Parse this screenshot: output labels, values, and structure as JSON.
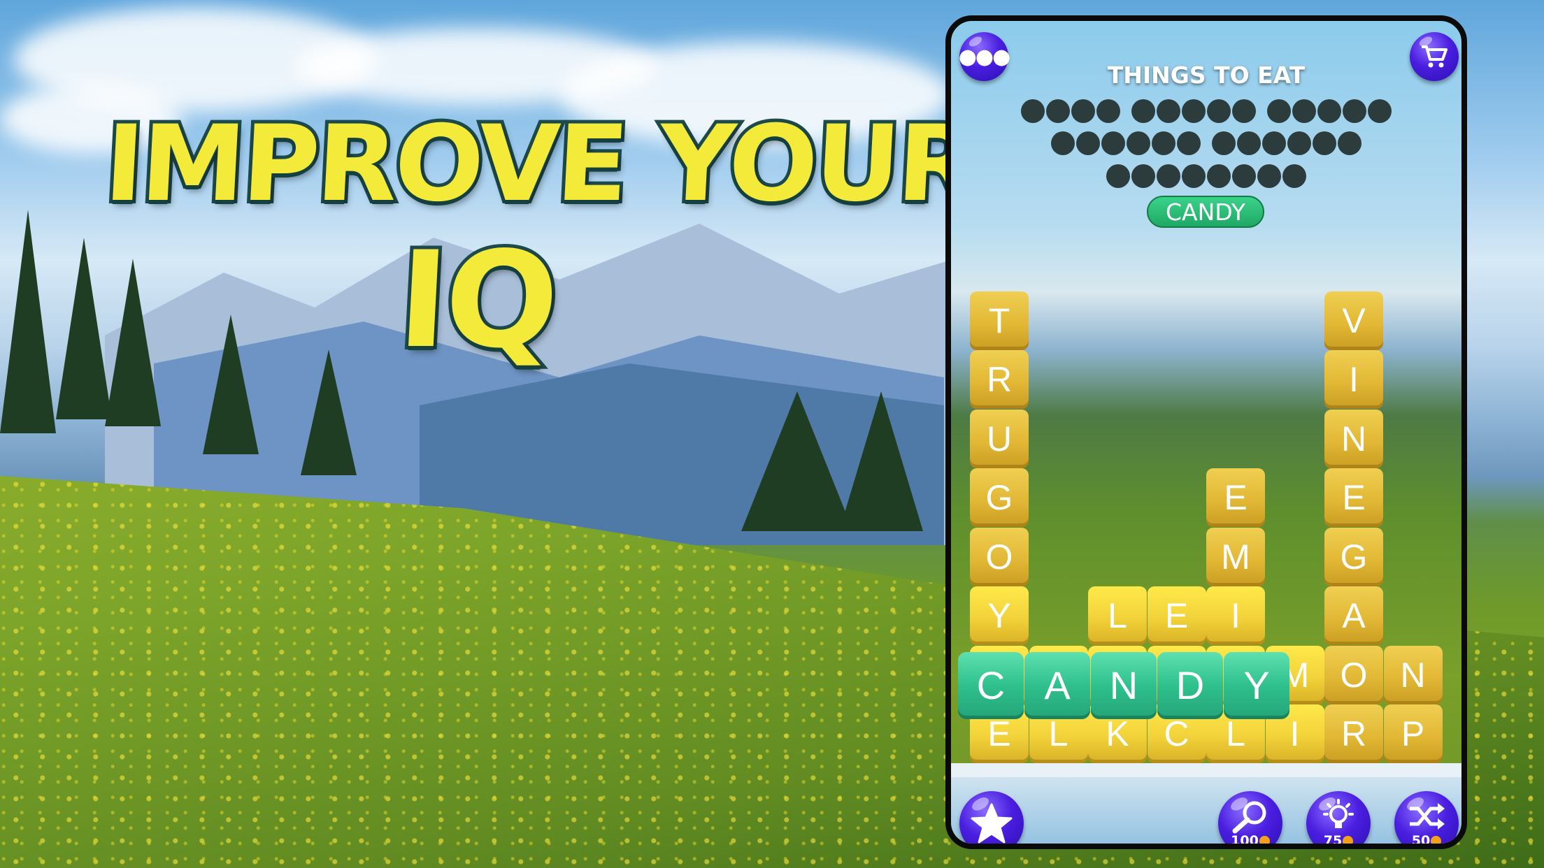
{
  "headline": {
    "line1": "IMPROVE YOUR",
    "line2": "IQ"
  },
  "game": {
    "category_title": "THINGS TO EAT",
    "hidden_word_lengths": [
      [
        4,
        5,
        5
      ],
      [
        6,
        6
      ],
      [
        8
      ]
    ],
    "found_words": [
      "CANDY"
    ],
    "grid_columns_bottom_to_top": [
      [
        "E",
        "C",
        "Y",
        "O",
        "G",
        "U",
        "R",
        "T"
      ],
      [
        "L",
        "A"
      ],
      [
        "K",
        "N",
        "L"
      ],
      [
        "C",
        "D",
        "E"
      ],
      [
        "L",
        "Y",
        "I",
        "M",
        "E"
      ],
      [
        "I",
        "M"
      ],
      [
        "R",
        "O",
        "A",
        "G",
        "E",
        "N",
        "I",
        "V"
      ],
      [
        "P",
        "N"
      ]
    ],
    "selected_word": [
      "C",
      "A",
      "N",
      "D",
      "Y"
    ],
    "buttons": {
      "menu": "more-icon",
      "shop": "cart-icon",
      "favorite": "star-icon",
      "reveal": {
        "icon": "magnifier-icon",
        "cost": "100"
      },
      "hint": {
        "icon": "bulb-icon",
        "cost": "75"
      },
      "shuffle": {
        "icon": "shuffle-icon",
        "cost": "50"
      }
    },
    "colors": {
      "tile": "#e2b835",
      "selected_tile": "#2fc08e",
      "button": "#4a1ee0",
      "found_pill": "#1fa865"
    }
  }
}
